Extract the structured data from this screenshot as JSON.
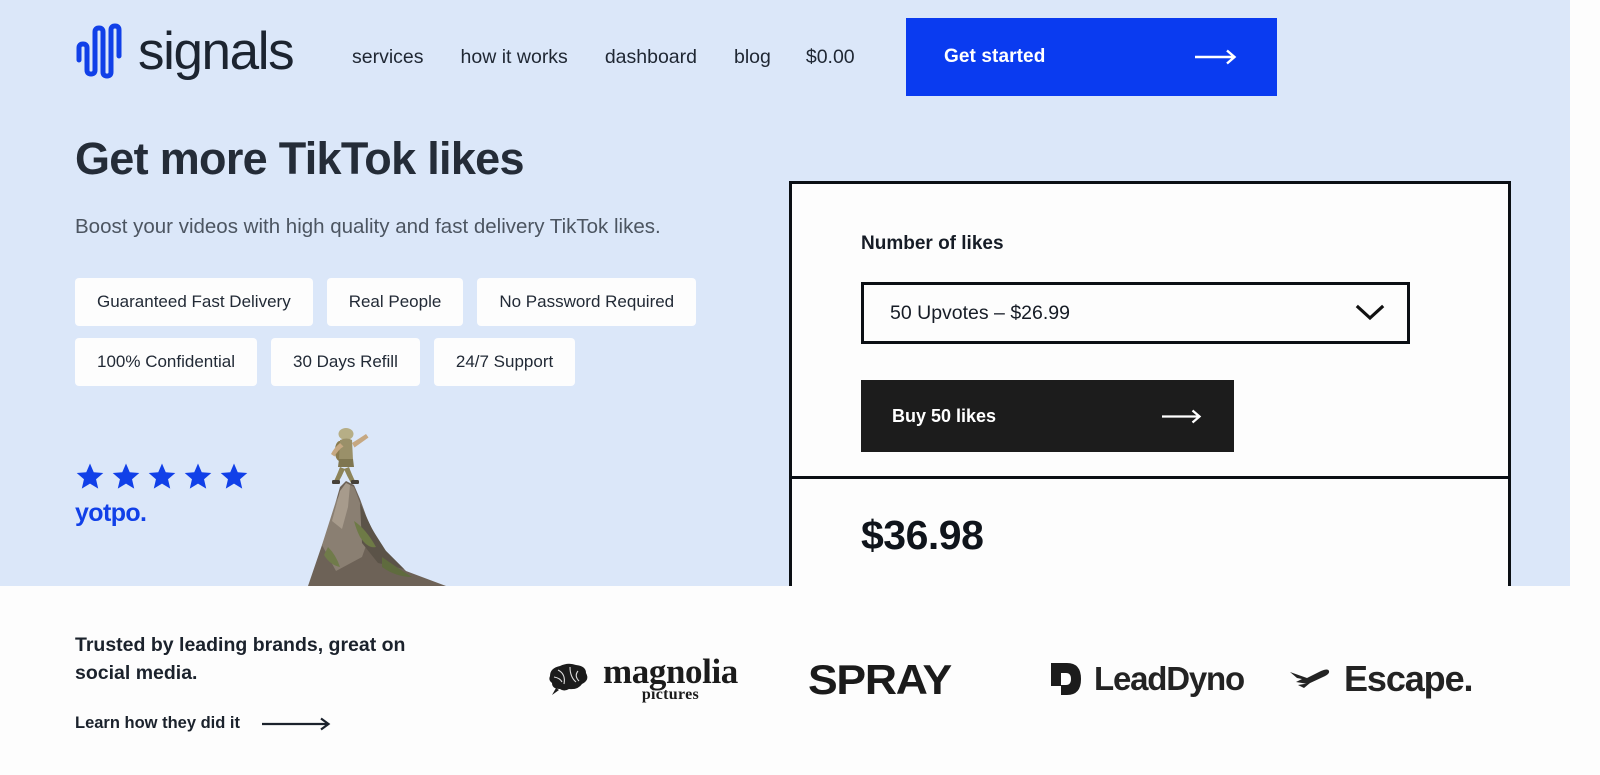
{
  "brand": {
    "name": "signals",
    "logo_icon": "waveform-icon",
    "accent_color": "#0a3bf0",
    "hero_bg_color": "#dbe7f9"
  },
  "nav": {
    "items": [
      {
        "label": "services"
      },
      {
        "label": "how it works"
      },
      {
        "label": "dashboard"
      },
      {
        "label": "blog"
      },
      {
        "label": "$0.00"
      }
    ],
    "cta": {
      "label": "Get started",
      "icon": "arrow-right-icon"
    }
  },
  "hero": {
    "headline": "Get more TikTok likes",
    "subheadline": "Boost your videos with high quality and fast delivery TikTok likes.",
    "badges": [
      {
        "label": "Guaranteed Fast Delivery"
      },
      {
        "label": "Real People"
      },
      {
        "label": "No Password Required"
      },
      {
        "label": "100% Confidential"
      },
      {
        "label": "30 Days Refill"
      },
      {
        "label": "24/7 Support"
      }
    ],
    "rating": {
      "stars": 5,
      "star_color": "#1140e8",
      "provider": "yotpo."
    },
    "image_alt": "climber-on-mountain-peak"
  },
  "order_card": {
    "field_label": "Number of likes",
    "select": {
      "value": "50 Upvotes – $26.99",
      "icon": "chevron-down-icon"
    },
    "buy_button": {
      "label": "Buy 50 likes",
      "icon": "arrow-right-icon"
    },
    "total_price": "$36.98"
  },
  "brands": {
    "heading": "Trusted by leading brands, great on social media.",
    "link": {
      "label": "Learn how they did it",
      "icon": "arrow-right-icon"
    },
    "logos": [
      {
        "name": "magnolia",
        "text": "magnolia",
        "subtext": "pictures",
        "icon": "brain-icon"
      },
      {
        "name": "spray",
        "text": "SPRAY"
      },
      {
        "name": "leaddyno",
        "text": "LeadDyno",
        "icon": "ld-monogram-icon"
      },
      {
        "name": "escape",
        "text": "Escape.",
        "icon": "airplane-icon"
      }
    ]
  }
}
